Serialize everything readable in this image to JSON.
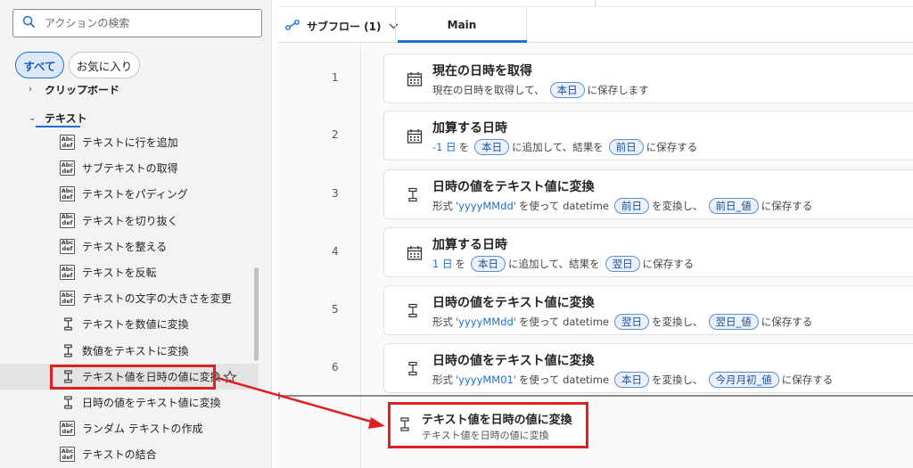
{
  "search": {
    "placeholder": "アクションの検索"
  },
  "filters": {
    "all_label": "すべて",
    "favorites_label": "お気に入り"
  },
  "tree": {
    "clipped_group_label": "クリップボード",
    "group_label": "テキスト",
    "actions": [
      {
        "label": "テキストに行を追加",
        "icon": "abc-def-icon"
      },
      {
        "label": "サブテキストの取得",
        "icon": "abc-def-icon"
      },
      {
        "label": "テキストをパディング",
        "icon": "abc-def-icon"
      },
      {
        "label": "テキストを切り抜く",
        "icon": "abc-def-icon"
      },
      {
        "label": "テキストを整える",
        "icon": "abc-def-icon"
      },
      {
        "label": "テキストを反転",
        "icon": "abc-def-icon"
      },
      {
        "label": "テキストの文字の大きさを変更",
        "icon": "abc-def-icon"
      },
      {
        "label": "テキストを数値に変換",
        "icon": "convert-icon"
      },
      {
        "label": "数値をテキストに変換",
        "icon": "convert-icon"
      },
      {
        "label": "テキスト値を日時の値に変換",
        "icon": "convert-icon",
        "selected": true
      },
      {
        "label": "日時の値をテキスト値に変換",
        "icon": "convert-icon"
      },
      {
        "label": "ランダム テキストの作成",
        "icon": "abc-def-icon"
      },
      {
        "label": "テキストの結合",
        "icon": "abc-def-icon"
      }
    ]
  },
  "icon_text": {
    "abc": "Abc",
    "def": "def"
  },
  "flow": {
    "subflow_label": "サブフロー (1)",
    "tab_main": "Main",
    "steps": [
      {
        "num": "1",
        "icon": "calendar-icon",
        "title": "現在の日時を取得",
        "desc": {
          "t1": "現在の日時を取得して、",
          "v1": "本日",
          "t2": "に保存します"
        }
      },
      {
        "num": "2",
        "icon": "calendar-icon",
        "title": "加算する日時",
        "desc": {
          "l1": "-1 日",
          "t1": "を",
          "v1": "本日",
          "t2": "に追加して、結果を",
          "v2": "前日",
          "t3": "に保存する"
        }
      },
      {
        "num": "3",
        "icon": "convert-icon",
        "title": "日時の値をテキスト値に変換",
        "desc": {
          "t0": "形式",
          "l1": "'yyyyMMdd'",
          "t1": "を使って datetime",
          "v1": "前日",
          "t2": "を変換し、",
          "v2": "前日_値",
          "t3": "に保存する"
        }
      },
      {
        "num": "4",
        "icon": "calendar-icon",
        "title": "加算する日時",
        "desc": {
          "l1": "1 日",
          "t1": "を",
          "v1": "本日",
          "t2": "に追加して、結果を",
          "v2": "翌日",
          "t3": "に保存する"
        }
      },
      {
        "num": "5",
        "icon": "convert-icon",
        "title": "日時の値をテキスト値に変換",
        "desc": {
          "t0": "形式",
          "l1": "'yyyyMMdd'",
          "t1": "を使って datetime",
          "v1": "翌日",
          "t2": "を変換し、",
          "v2": "翌日_値",
          "t3": "に保存する"
        }
      },
      {
        "num": "6",
        "icon": "convert-icon",
        "title": "日時の値をテキスト値に変換",
        "desc": {
          "t0": "形式",
          "l1": "'yyyyMM01'",
          "t1": "を使って datetime",
          "v1": "本日",
          "t2": "を変換し、",
          "v2": "今月月初_値",
          "t3": "に保存する"
        }
      }
    ],
    "drag_preview": {
      "title": "テキスト値を日時の値に変換",
      "desc": "テキスト値を日時の値に変換"
    }
  },
  "colors": {
    "accent": "#1f6fd1",
    "highlight": "#e02020",
    "variable_bg": "#eaf1fb"
  }
}
